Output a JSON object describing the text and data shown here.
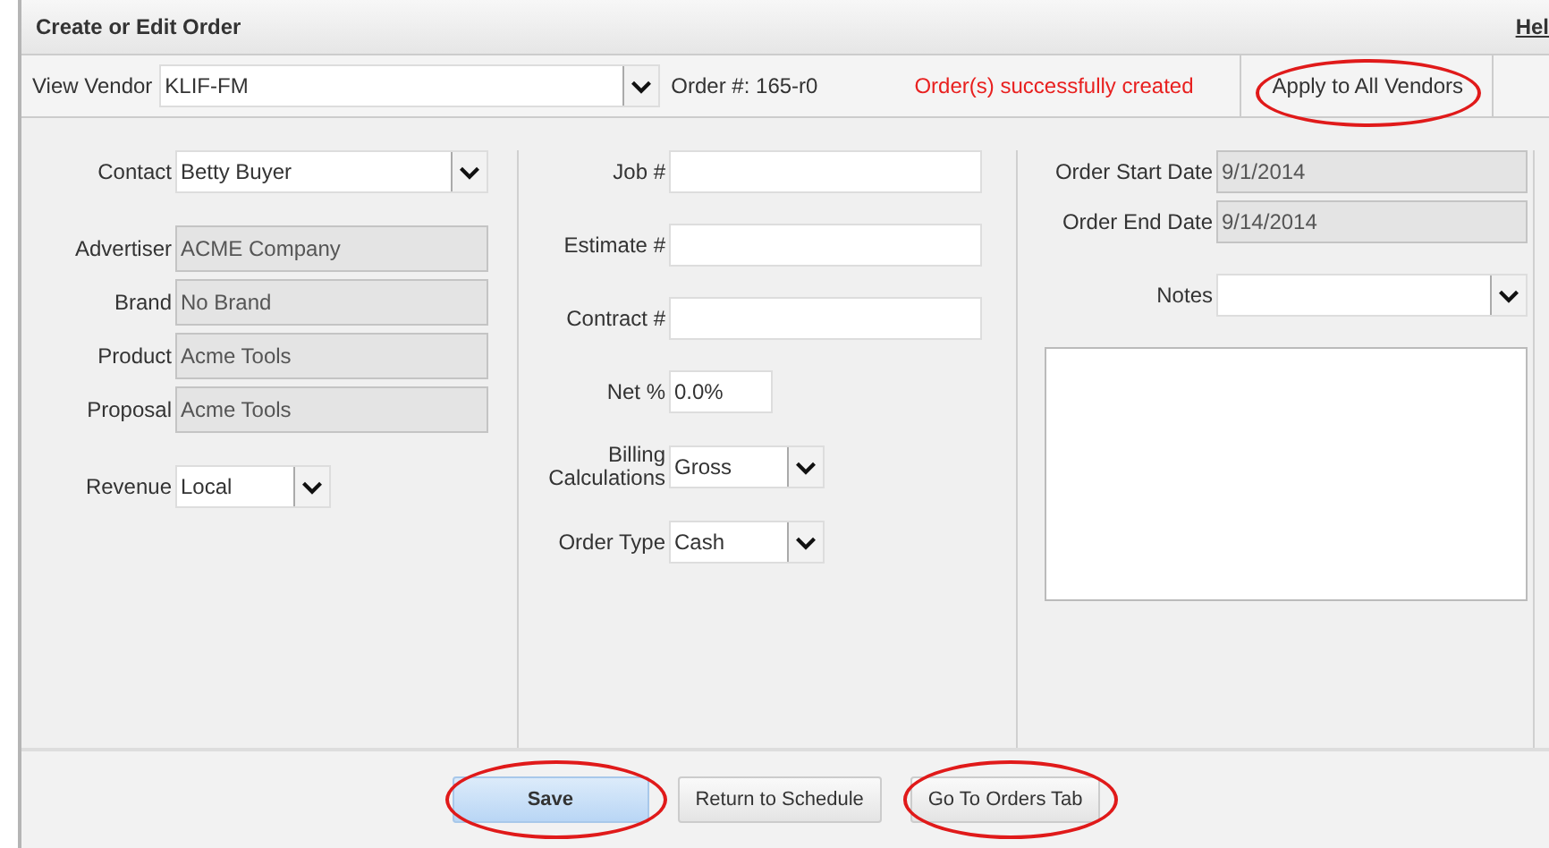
{
  "window": {
    "title": "Create or Edit Order",
    "help_link": "Hel"
  },
  "toolbar": {
    "vendor_label": "View Vendor",
    "vendor": "KLIF-FM",
    "order_number": "Order #: 165-r0",
    "message": "Order(s) successfully created",
    "apply_button": {
      "label": "Apply to All Vendors",
      "highlighted": true
    }
  },
  "columns": [
    {
      "groups": [
        [
          {
            "kind": "select",
            "label": "Contact",
            "value": "Betty Buyer"
          }
        ],
        [
          {
            "kind": "readonly",
            "label": "Advertiser",
            "value": "ACME Company"
          },
          {
            "kind": "readonly",
            "label": "Brand",
            "value": "No Brand"
          },
          {
            "kind": "readonly",
            "label": "Product",
            "value": "Acme Tools"
          },
          {
            "kind": "readonly",
            "label": "Proposal",
            "value": "Acme Tools"
          }
        ],
        [
          {
            "kind": "short-select",
            "label": "Revenue",
            "value": "Local"
          }
        ]
      ]
    },
    {
      "groups": [
        [
          {
            "kind": "text",
            "label": "Job #"
          }
        ],
        [
          {
            "kind": "text",
            "label": "Estimate #"
          }
        ],
        [
          {
            "kind": "text",
            "label": "Contract #"
          }
        ],
        [
          {
            "kind": "short-text",
            "label": "Net %",
            "value": "0.0%"
          }
        ],
        [
          {
            "kind": "short-select",
            "label": "Billing Calculations",
            "value": "Gross"
          }
        ],
        [
          {
            "kind": "short-select",
            "label": "Order Type",
            "value": "Cash"
          }
        ]
      ]
    },
    {
      "groups": [
        [
          {
            "kind": "readonly",
            "label": "Order Start Date",
            "value": "9/1/2014"
          },
          {
            "kind": "readonly",
            "label": "Order End Date",
            "value": "9/14/2014"
          }
        ],
        [
          {
            "kind": "select",
            "label": "Notes"
          }
        ],
        [
          {
            "kind": "textarea"
          }
        ]
      ]
    }
  ],
  "footer_buttons": [
    {
      "label": "Save",
      "primary": true,
      "highlighted": true
    },
    {
      "label": "Return to Schedule",
      "primary": false,
      "highlighted": false
    },
    {
      "label": "Go To Orders Tab",
      "primary": false,
      "highlighted": true
    }
  ]
}
